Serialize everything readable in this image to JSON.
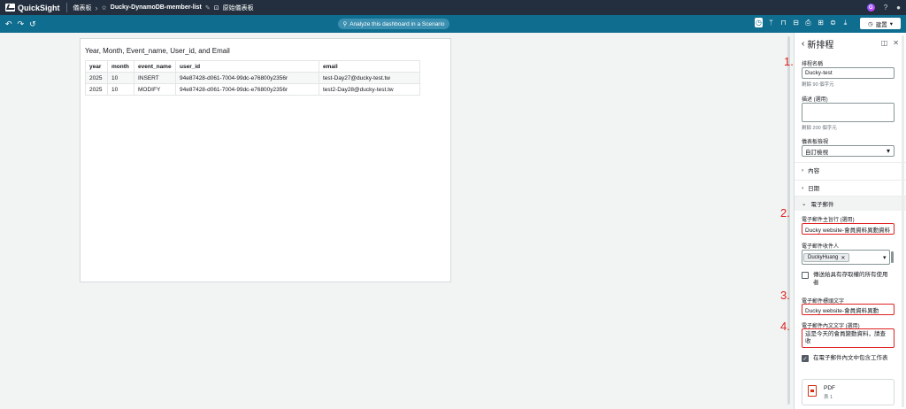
{
  "topbar": {
    "app_name": "QuickSight",
    "crumb_dashboards": "儀表板",
    "crumb_analysis": "Ducky-DynamoDB-member-list",
    "crumb_dashboard": "原始儀表板"
  },
  "toolbar": {
    "undo": "↶",
    "redo": "↷",
    "reset": "↺",
    "analyze_label": "Analyze this dashboard in a Scenario",
    "share_label": "建置"
  },
  "visual": {
    "title": "Year, Month, Event_name, User_id, and Email",
    "columns": [
      "year",
      "month",
      "event_name",
      "user_id",
      "email"
    ],
    "rows": [
      [
        "2025",
        "10",
        "INSERT",
        "94e87428-d061-7004-99dc-e76800y2356r",
        "test-Day27@ducky-test.tw"
      ],
      [
        "2025",
        "10",
        "MODIFY",
        "94e87428-d061-7004-99dc-e76800y2356r",
        "test2-Day28@ducky-test.tw"
      ]
    ]
  },
  "panel": {
    "title": "新排程",
    "schedule_name_label": "排程名稱",
    "schedule_name_value": "Ducky-test",
    "schedule_name_hint": "剩餘 90 個字元",
    "description_label": "描述 (選用)",
    "description_value": "",
    "description_hint": "剩餘 200 個字元",
    "view_label": "儀表板檢視",
    "view_value": "自訂檢視",
    "section_content": "內容",
    "section_date": "日期",
    "section_email": "電子郵件",
    "subject_label": "電子郵件主旨行 (選用)",
    "subject_value": "Ducky website-會員資料異動資料",
    "recipients_label": "電子郵件收件人",
    "recipient_chip": "DuckyHuang",
    "send_all_label": "傳送給具有存取權的所有使用者",
    "header_label": "電子郵件標頭文字",
    "header_value": "Ducky website-會員資料異動",
    "body_label": "電子郵件內文文字 (選用)",
    "body_value": "這是今天的會員變動資料，請查收",
    "include_sheet_label": "在電子郵件內文中包含工作表",
    "attachment_name": "PDF",
    "attachment_sub": "表 1"
  },
  "annotations": [
    "1.",
    "2.",
    "3.",
    "4."
  ],
  "colors": {
    "topbar": "#232f3e",
    "toolbar": "#0f6d8f",
    "highlight": "#e02020"
  }
}
